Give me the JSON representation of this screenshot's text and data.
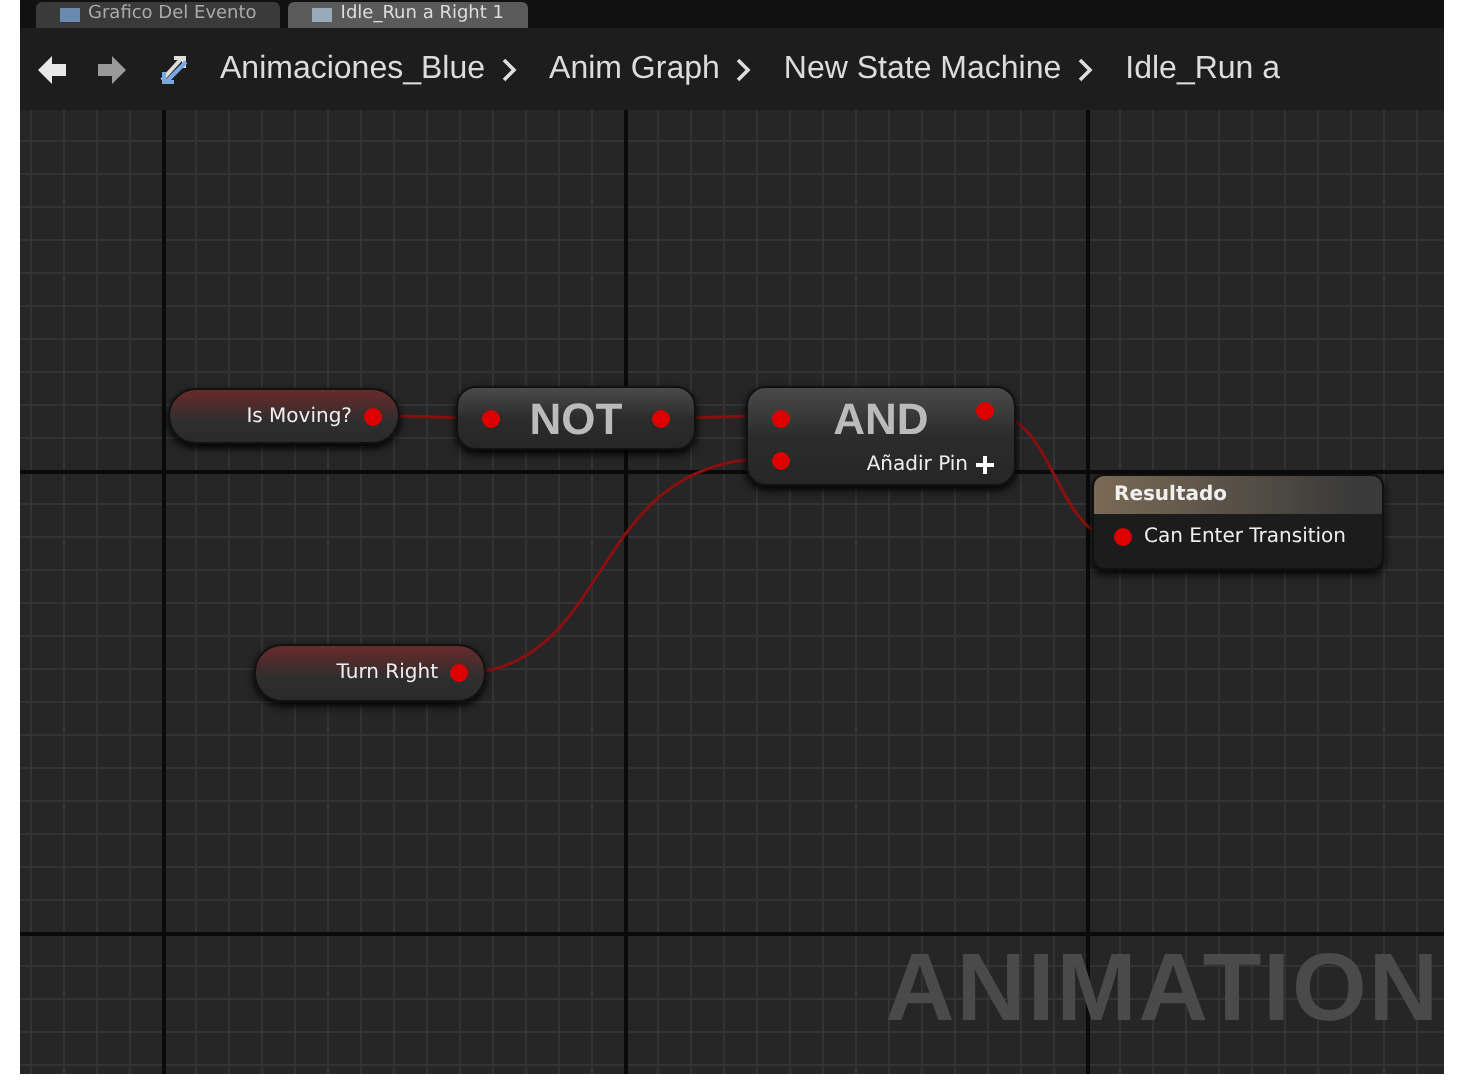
{
  "tabs": [
    {
      "label": "Grafico Del Evento",
      "selected": false
    },
    {
      "label": "Idle_Run a Right 1",
      "selected": true
    }
  ],
  "breadcrumb": [
    "Animaciones_Blue",
    "Anim Graph",
    "New State Machine",
    "Idle_Run a"
  ],
  "nodes": [
    {
      "kind": "getter",
      "label": "Is Moving?"
    },
    {
      "kind": "operator",
      "label": "NOT"
    },
    {
      "kind": "operator_add",
      "label": "AND",
      "add_pin": "Añadir Pin"
    },
    {
      "kind": "getter",
      "label": "Turn Right"
    },
    {
      "kind": "result",
      "title": "Resultado",
      "pin": "Can Enter Transition"
    }
  ],
  "watermark": "ANIMATION"
}
